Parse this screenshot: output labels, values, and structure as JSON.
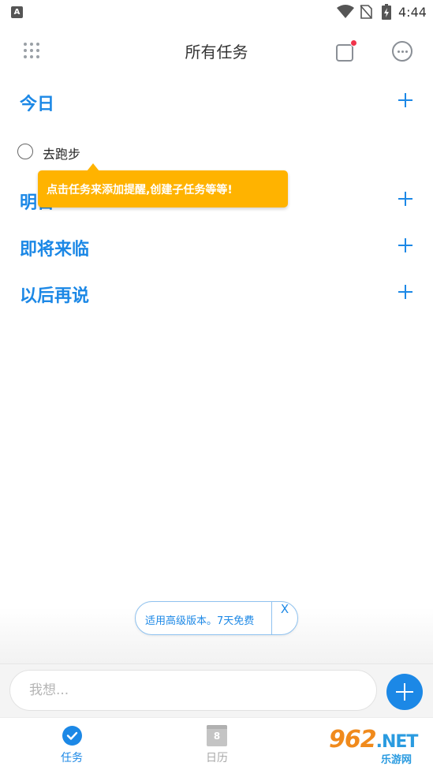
{
  "status_bar": {
    "app_badge": "A",
    "time": "4:44"
  },
  "header": {
    "title": "所有任务"
  },
  "sections": [
    {
      "title": "今日"
    },
    {
      "title": "明日"
    },
    {
      "title": "即将来临"
    },
    {
      "title": "以后再说"
    }
  ],
  "today_tasks": [
    {
      "label": "去跑步",
      "done": false
    }
  ],
  "tooltip": {
    "text": "点击任务来添加提醒,创建子任务等等!"
  },
  "promo": {
    "text": "适用高级版本。7天免费",
    "close_label": "X"
  },
  "input": {
    "placeholder": "我想..."
  },
  "bottom_nav": {
    "tasks_label": "任务",
    "calendar_label": "日历",
    "calendar_day": "8"
  },
  "watermark": {
    "big": "962",
    "suffix": ".NET",
    "small": "乐游网"
  },
  "colors": {
    "accent": "#1c88e6",
    "tooltip": "#ffb300",
    "badge": "#f0334b"
  }
}
